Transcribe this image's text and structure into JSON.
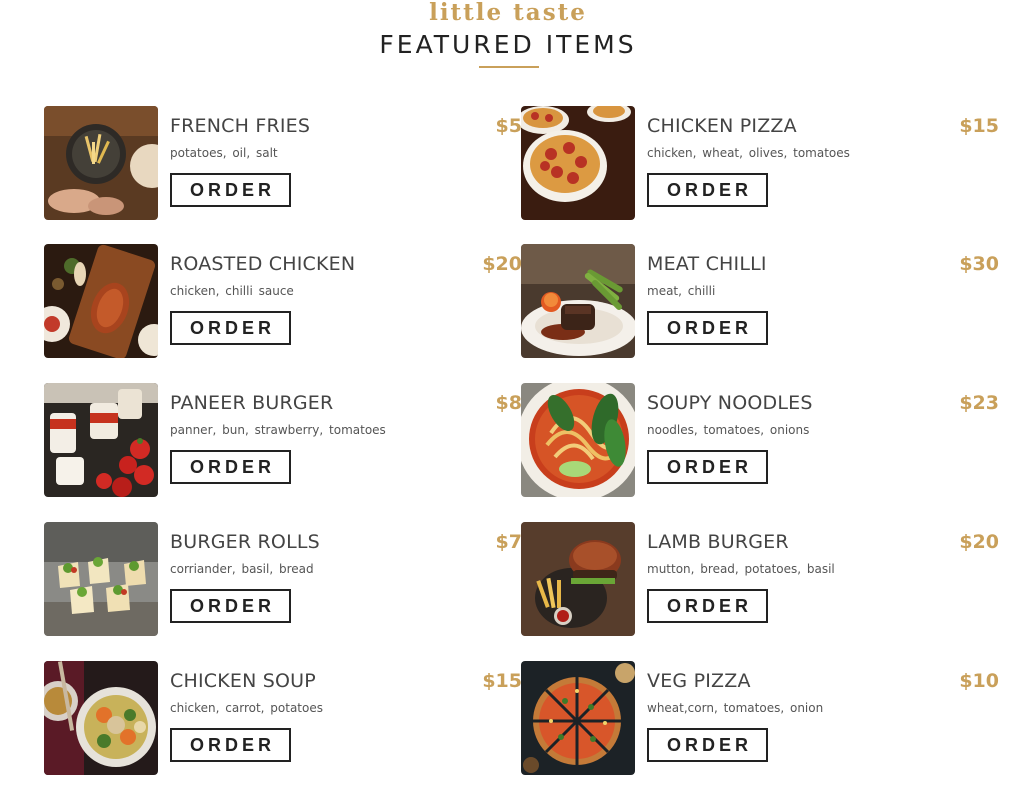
{
  "header": {
    "script_title": "little taste",
    "section_title": "FEATURED ITEMS",
    "accent_color": "#c9a05a"
  },
  "items": [
    {
      "name": "FRENCH FRIES",
      "price": "$5",
      "ingredients": "potatoes, oil, salt",
      "order_label": "ORDER",
      "image": "french-fries-photo"
    },
    {
      "name": "CHICKEN PIZZA",
      "price": "$15",
      "ingredients": "chicken, wheat, olives, tomatoes",
      "order_label": "ORDER",
      "image": "chicken-pizza-photo"
    },
    {
      "name": "ROASTED CHICKEN",
      "price": "$20",
      "ingredients": "chicken, chilli sauce",
      "order_label": "ORDER",
      "image": "roasted-chicken-photo"
    },
    {
      "name": "MEAT CHILLI",
      "price": "$30",
      "ingredients": "meat, chilli",
      "order_label": "ORDER",
      "image": "meat-chilli-photo"
    },
    {
      "name": "PANEER BURGER",
      "price": "$8",
      "ingredients": "panner, bun, strawberry, tomatoes",
      "order_label": "ORDER",
      "image": "paneer-burger-photo"
    },
    {
      "name": "SOUPY NOODLES",
      "price": "$23",
      "ingredients": "noodles, tomatoes, onions",
      "order_label": "ORDER",
      "image": "soupy-noodles-photo"
    },
    {
      "name": "BURGER ROLLS",
      "price": "$7",
      "ingredients": "corriander, basil, bread",
      "order_label": "ORDER",
      "image": "burger-rolls-photo"
    },
    {
      "name": "LAMB BURGER",
      "price": "$20",
      "ingredients": "mutton, bread, potatoes, basil",
      "order_label": "ORDER",
      "image": "lamb-burger-photo"
    },
    {
      "name": "CHICKEN SOUP",
      "price": "$15",
      "ingredients": "chicken, carrot, potatoes",
      "order_label": "ORDER",
      "image": "chicken-soup-photo"
    },
    {
      "name": "VEG PIZZA",
      "price": "$10",
      "ingredients": "wheat,corn, tomatoes, onion",
      "order_label": "ORDER",
      "image": "veg-pizza-photo"
    }
  ]
}
